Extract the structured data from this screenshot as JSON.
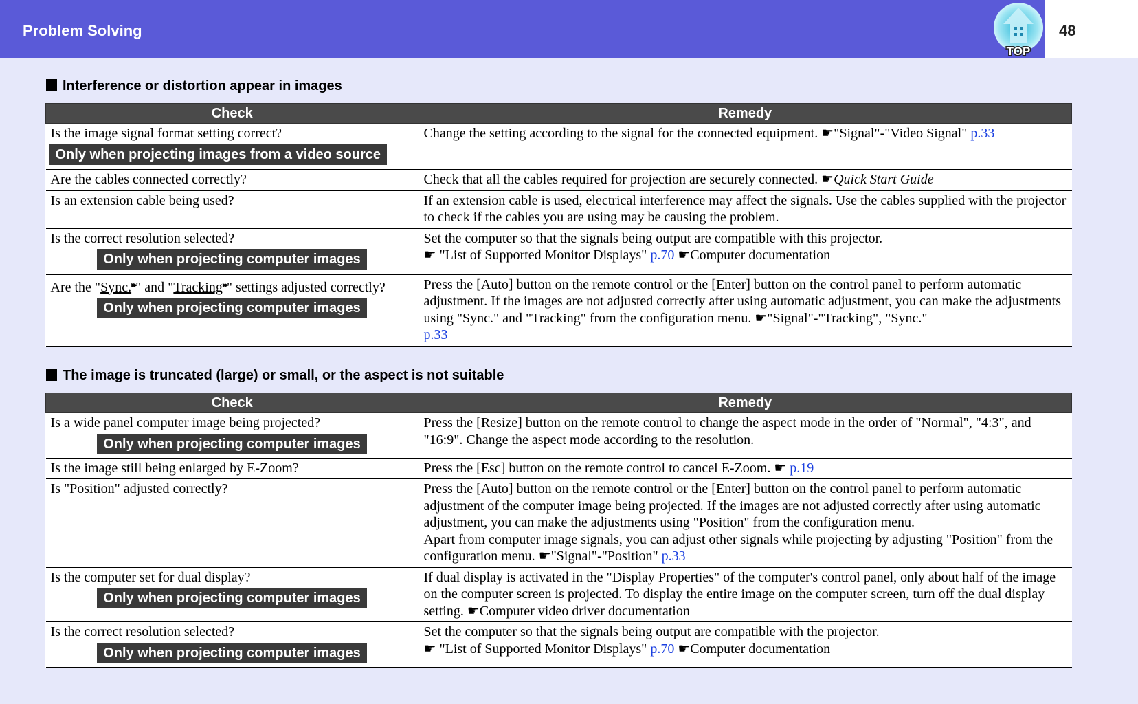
{
  "header": {
    "title": "Problem Solving",
    "page_number": "48",
    "top_button_label": "TOP"
  },
  "icons": {
    "pointer": "☛",
    "glossary_arrow": "▸▸"
  },
  "colors": {
    "header_bg": "#5a5ad8",
    "page_bg": "#e6e8fa",
    "table_header_bg": "#4a4a4a",
    "badge_bg": "#3a3a3a",
    "link": "#1a3fe0"
  },
  "sections": [
    {
      "title": "Interference or distortion appear in images",
      "columns": [
        "Check",
        "Remedy"
      ],
      "rows": [
        {
          "check": "Is the image signal format setting correct?",
          "badge": "Only when projecting images from a video source",
          "remedy_text": "Change the setting according to the signal for the connected equipment. ",
          "remedy_ref": "\"Signal\"-\"Video Signal\"  ",
          "remedy_link": "p.33"
        },
        {
          "check": "Are the cables connected correctly?",
          "remedy_text": "Check that all the cables required for projection are securely connected. ",
          "remedy_ref_italic": "Quick Start Guide"
        },
        {
          "check": "Is an extension cable being used?",
          "remedy_text": "If an extension cable is used, electrical interference may affect the signals. Use the cables supplied with the projector to check if the cables you are using may be causing the problem."
        },
        {
          "check": "Is the correct resolution selected?",
          "badge": "Only when projecting computer images",
          "remedy_text": "Set the computer so that the signals being output are compatible with this projector.",
          "remedy_ref": " \"List of Supported Monitor Displays\"  ",
          "remedy_link": "p.70",
          "remedy_ref2": "Computer documentation"
        },
        {
          "check_prefix": "Are the \"",
          "check_term1": "Sync.",
          "check_mid": "\" and \"",
          "check_term2": "Tracking",
          "check_suffix": "\" settings adjusted correctly?",
          "badge": "Only when projecting computer images",
          "remedy_text": "Press the [Auto] button on the remote control or the [Enter] button on the control panel to perform automatic adjustment. If the images are not adjusted correctly after using automatic adjustment, you can make the adjustments using \"Sync.\" and \"Tracking\" from the configuration menu. ",
          "remedy_ref": "\"Signal\"-\"Tracking\", \"Sync.\"",
          "remedy_link": "p.33"
        }
      ]
    },
    {
      "title": "The image is truncated (large) or small, or the aspect is not suitable",
      "columns": [
        "Check",
        "Remedy"
      ],
      "rows": [
        {
          "check": "Is a wide panel computer image being projected?",
          "badge": "Only when projecting computer images",
          "remedy_text": "Press the [Resize] button on the remote control to change the aspect mode in the order of \"Normal\", \"4:3\", and \"16:9\". Change the aspect mode according to the resolution."
        },
        {
          "check": "Is the image still being enlarged by E-Zoom?",
          "remedy_text": "Press the [Esc] button on the remote control to cancel E-Zoom. ",
          "remedy_link": "p.19"
        },
        {
          "check": "Is \"Position\" adjusted correctly?",
          "remedy_text": "Press the [Auto] button on the remote control or the [Enter] button on the control panel to perform automatic adjustment of the computer image being projected. If the images are not adjusted correctly after using automatic adjustment, you can make the adjustments using \"Position\" from the configuration menu.",
          "remedy_text2": "Apart from computer image signals, you can adjust other signals while projecting by adjusting \"Position\" from the configuration menu. ",
          "remedy_ref": "\"Signal\"-\"Position\" ",
          "remedy_link": "p.33"
        },
        {
          "check": "Is the computer set for dual display?",
          "badge": "Only when projecting computer images",
          "remedy_text": "If dual display is activated in the \"Display Properties\" of the computer's control panel, only about half of the image on the computer screen is projected. To display the entire image on the computer screen, turn off the dual display setting. ",
          "remedy_ref": "Computer video driver documentation"
        },
        {
          "check": "Is the correct resolution selected?",
          "badge": "Only when projecting computer images",
          "remedy_text": "Set the computer so that the signals being output are compatible with the projector.",
          "remedy_ref": " \"List of Supported Monitor Displays\"  ",
          "remedy_link": "p.70",
          "remedy_ref2": "Computer documentation"
        }
      ]
    }
  ]
}
